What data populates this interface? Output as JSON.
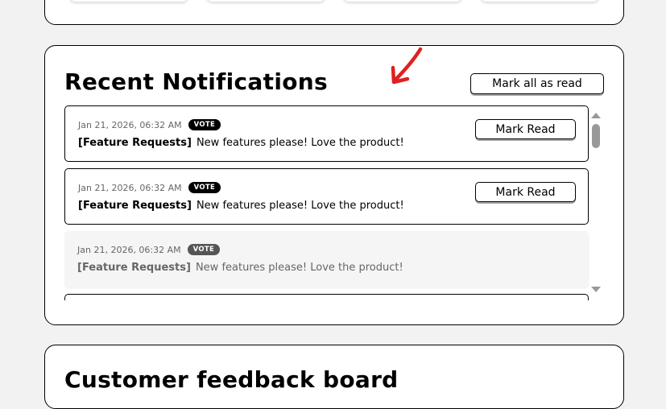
{
  "section": {
    "title": "Recent Notifications",
    "mark_all_label": "Mark all as read"
  },
  "notifications": [
    {
      "timestamp": "Jan 21, 2026, 06:32 AM",
      "badge": "VOTE",
      "category": "[Feature Requests]",
      "message": "New features please! Love the product!",
      "read": false,
      "action_label": "Mark Read"
    },
    {
      "timestamp": "Jan 21, 2026, 06:32 AM",
      "badge": "VOTE",
      "category": "[Feature Requests]",
      "message": "New features please! Love the product!",
      "read": false,
      "action_label": "Mark Read"
    },
    {
      "timestamp": "Jan 21, 2026, 06:32 AM",
      "badge": "VOTE",
      "category": "[Feature Requests]",
      "message": "New features please! Love the product!",
      "read": true
    }
  ],
  "next_section": {
    "title": "Customer feedback board"
  },
  "colors": {
    "annotation": "#e02020",
    "background": "#f2f2f2",
    "badge": "#000000"
  },
  "icons": {
    "annotation": "red-arrow-icon",
    "scroll_up": "triangle-up-icon",
    "scroll_down": "triangle-down-icon"
  }
}
